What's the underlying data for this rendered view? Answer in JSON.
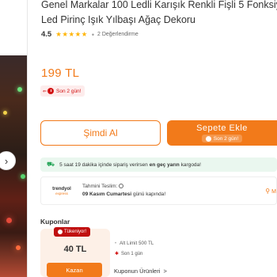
{
  "product": {
    "title_line1": "Genel Markalar 100 Ledli Karışık Renkli Fişli 5 Fonksiyo",
    "title_line2": "Led Pirinç Işık Yılbaşı Ağaç Dekoru",
    "rating": "4.5",
    "stars": "★★★★★",
    "review_count": "2 Değerlendirme",
    "price": "199 TL",
    "last_days_badge": "Son 2 gün!"
  },
  "actions": {
    "buy_now": "Şimdi Al",
    "add_to_cart": "Sepete Ekle",
    "add_to_cart_sub": "Son 2 gün!"
  },
  "shipping": {
    "timer_text": "5 saat 19 dakika",
    "middle_text": "içinde sipariş verirsen",
    "highlight": "en geç yarın",
    "end_text": "kargoda!"
  },
  "delivery": {
    "logo_top": "trendyol",
    "logo_bottom": "express",
    "title": "Tahmini Teslim:",
    "date": "09 Kasım Cumartesi",
    "date_suffix": "günü kapında!",
    "location": "M"
  },
  "coupons": {
    "heading": "Kuponlar",
    "badge": "Tükeniyor!",
    "amount": "40 TL",
    "button": "Kazan",
    "cond_limit": "Alt Limit 500 TL",
    "cond_time": "Son 1 gün",
    "link": "Kuponun Ürünleri"
  },
  "colors": {
    "brand_orange": "#f27a1a",
    "alert_red": "#d21313",
    "shipping_green": "#2aa75c"
  },
  "icons": {
    "nav": "chevron-right-icon",
    "clock": "clock-icon",
    "truck": "truck-icon",
    "pin": "location-pin-icon"
  }
}
